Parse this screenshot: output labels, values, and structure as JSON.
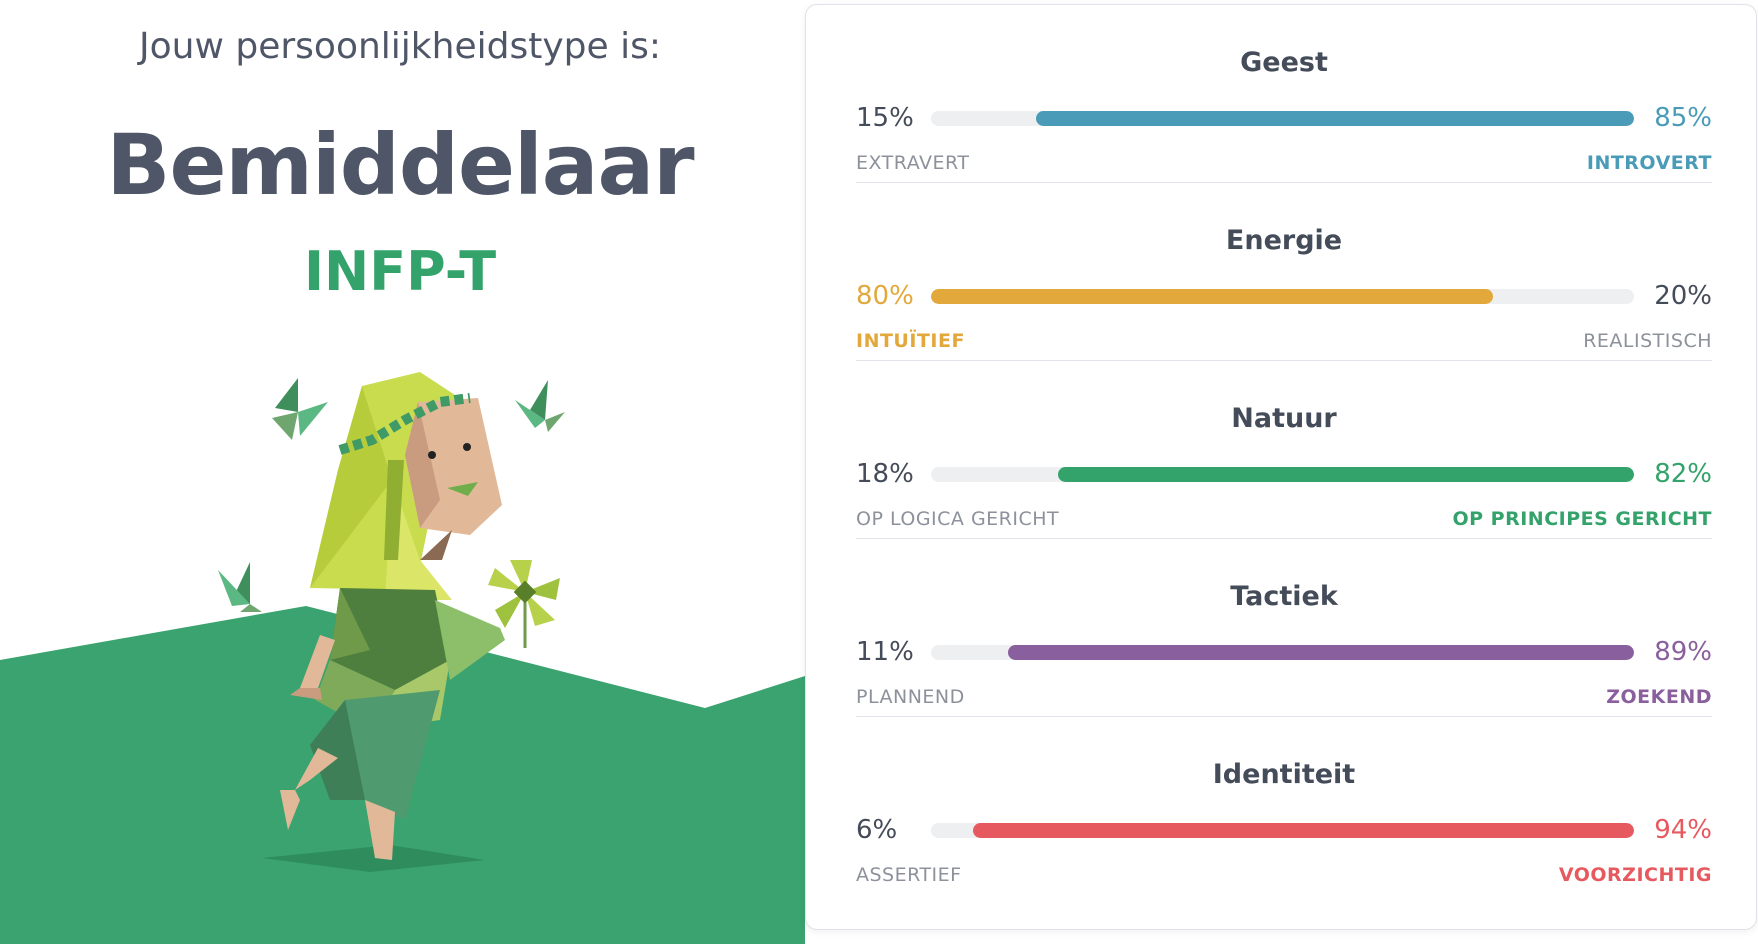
{
  "header": {
    "intro": "Jouw persoonlijkheidstype is:",
    "type_name": "Bemiddelaar",
    "type_code": "INFP-T"
  },
  "illustration": {
    "icon": "mediator-character-illustration"
  },
  "traits": [
    {
      "title": "Geest",
      "left_pct": "15%",
      "right_pct": "85%",
      "left_label": "EXTRAVERT",
      "right_label": "INTROVERT",
      "dominant": "right",
      "value": 85,
      "color": "#4a9bb8"
    },
    {
      "title": "Energie",
      "left_pct": "80%",
      "right_pct": "20%",
      "left_label": "INTUÏTIEF",
      "right_label": "REALISTISCH",
      "dominant": "left",
      "value": 80,
      "color": "#e3a83b"
    },
    {
      "title": "Natuur",
      "left_pct": "18%",
      "right_pct": "82%",
      "left_label": "OP LOGICA GERICHT",
      "right_label": "OP PRINCIPES GERICHT",
      "dominant": "right",
      "value": 82,
      "color": "#34a36b"
    },
    {
      "title": "Tactiek",
      "left_pct": "11%",
      "right_pct": "89%",
      "left_label": "PLANNEND",
      "right_label": "ZOEKEND",
      "dominant": "right",
      "value": 89,
      "color": "#8a5f9e"
    },
    {
      "title": "Identiteit",
      "left_pct": "6%",
      "right_pct": "94%",
      "left_label": "ASSERTIEF",
      "right_label": "VOORZICHTIG",
      "dominant": "right",
      "value": 94,
      "color": "#e65a5f"
    }
  ]
}
